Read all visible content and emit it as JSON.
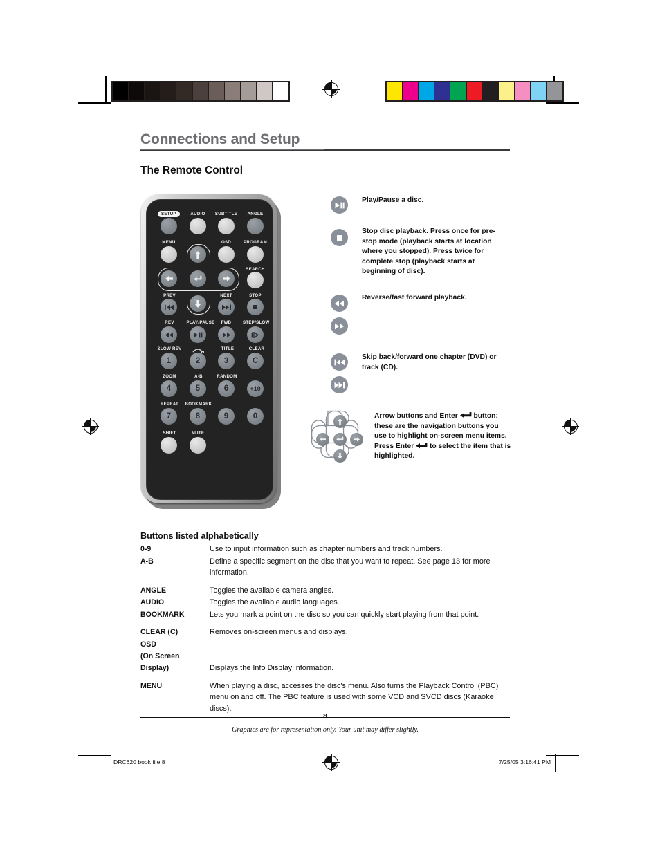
{
  "document": {
    "chapter_title": "Connections and Setup",
    "section_title": "The Remote Control",
    "page_number": "8",
    "footnote": "Graphics are for representation only. Your unit may differ slightly.",
    "slug_left": "DRC620 book file   8",
    "slug_right": "7/25/05   3:16:41 PM"
  },
  "color_bars": {
    "grayscale": [
      "#000000",
      "#0d0a09",
      "#1a1513",
      "#241d1a",
      "#332a26",
      "#4b403b",
      "#6b5d57",
      "#8b7e78",
      "#a69c97",
      "#cfc8c4",
      "#ffffff"
    ],
    "color": [
      "#ffe600",
      "#ec008c",
      "#00a7e7",
      "#2e3191",
      "#00a451",
      "#ed1c24",
      "#231f20",
      "#fbf08a",
      "#f58fc2",
      "#7fd4f5",
      "#939598"
    ]
  },
  "remote": {
    "rows": [
      {
        "labels": [
          "SETUP",
          "AUDIO",
          "SUBTITLE",
          "ANGLE"
        ],
        "buttons": [
          "",
          "",
          "",
          ""
        ]
      },
      {
        "labels": [
          "MENU",
          "",
          "OSD",
          "PROGRAM"
        ],
        "buttons": [
          "",
          "",
          "",
          ""
        ]
      },
      {
        "labels": [
          "",
          "",
          "",
          "SEARCH"
        ],
        "buttons": [
          "",
          "",
          "",
          ""
        ]
      },
      {
        "labels": [
          "PREV",
          "",
          "NEXT",
          "STOP"
        ],
        "buttons": [
          "",
          "",
          "",
          ""
        ]
      },
      {
        "labels": [
          "REV",
          "PLAY/PAUSE",
          "FWD",
          "STEP/SLOW"
        ],
        "buttons": [
          "",
          "",
          "",
          ""
        ]
      },
      {
        "labels": [
          "SLOW REV",
          "",
          "TITLE",
          "CLEAR"
        ],
        "buttons": [
          "1",
          "2",
          "3",
          "C"
        ]
      },
      {
        "labels": [
          "ZOOM",
          "A-B",
          "RANDOM",
          ""
        ],
        "buttons": [
          "4",
          "5",
          "6",
          "+10"
        ]
      },
      {
        "labels": [
          "REPEAT",
          "BOOKMARK",
          "",
          ""
        ],
        "buttons": [
          "7",
          "8",
          "9",
          "0"
        ]
      },
      {
        "labels": [
          "SHIFT",
          "MUTE",
          "",
          ""
        ],
        "buttons": [
          "",
          ""
        ]
      }
    ],
    "setup_label": "SETUP",
    "audio_label": "AUDIO",
    "subtitle_label": "SUBTITLE",
    "angle_label": "ANGLE",
    "menu_label": "MENU",
    "osd_label": "OSD",
    "program_label": "PROGRAM",
    "search_label": "SEARCH",
    "prev_label": "PREV",
    "next_label": "NEXT",
    "stop_label": "STOP",
    "rev_label": "REV",
    "play_pause_label": "PLAY/PAUSE",
    "fwd_label": "FWD",
    "step_slow_label": "STEP/SLOW",
    "slow_rev_label": "SLOW REV",
    "title_label": "TITLE",
    "clear_label": "CLEAR",
    "zoom_label": "ZOOM",
    "ab_label": "A-B",
    "random_label": "RANDOM",
    "repeat_label": "REPEAT",
    "bookmark_label": "BOOKMARK",
    "shift_label": "SHIFT",
    "mute_label": "MUTE",
    "num1": "1",
    "num2": "2",
    "num3": "3",
    "numC": "C",
    "num4": "4",
    "num5": "5",
    "num6": "6",
    "numPlus10": "+10",
    "num7": "7",
    "num8": "8",
    "num9": "9",
    "num0": "0"
  },
  "annotations": [
    {
      "icon": "play-pause-icon",
      "text": "Play/Pause a disc."
    },
    {
      "icon": "stop-icon",
      "text": "Stop disc playback. Press once for pre-stop mode (playback starts at location where you stopped). Press twice for complete stop (playback starts at beginning of disc)."
    },
    {
      "icon": "rewind-icon",
      "icon2": "fast-forward-icon",
      "text": "Reverse/fast forward playback."
    },
    {
      "icon": "skip-back-icon",
      "icon2": "skip-forward-icon",
      "text": "Skip back/forward one chapter (DVD) or track (CD)."
    },
    {
      "icon": "dpad-icon",
      "text": "Arrow buttons and Enter ↩ button: these are the navigation buttons you use to highlight on-screen menu items. Press Enter ↩ to select the item that is highlighted."
    }
  ],
  "annotation_texts": {
    "play_pause": "Play/Pause a disc.",
    "stop": "Stop disc playback. Press once for pre-stop mode (playback starts at location where you stopped). Press twice for complete stop (playback starts at beginning of disc).",
    "reverse_forward": "Reverse/fast forward playback.",
    "skip": "Skip back/forward one chapter (DVD) or track (CD).",
    "navigation_a": "Arrow buttons and Enter ",
    "navigation_b": " button: these are the navigation buttons you use to highlight on-screen menu items. Press Enter ",
    "navigation_c": " to select the item that is highlighted."
  },
  "alphabetical": {
    "title": "Buttons listed alphabetically",
    "entries": [
      {
        "term": "0-9",
        "desc": "Use to input information such as chapter numbers and track numbers.",
        "gap": false
      },
      {
        "term": "A-B",
        "desc": "Define a specific segment on the disc that you want to repeat. See page 13 for more information.",
        "gap": false
      },
      {
        "term": "ANGLE",
        "desc": "Toggles the available camera angles.",
        "gap": true
      },
      {
        "term": "AUDIO",
        "desc": "Toggles the available audio languages.",
        "gap": false
      },
      {
        "term": "BOOKMARK",
        "desc": "Lets you mark a point on the disc so you can quickly start playing from that point.",
        "gap": false
      },
      {
        "term": "CLEAR (C)",
        "desc": "Removes on-screen menus and displays.",
        "gap": true
      },
      {
        "term": "OSD",
        "desc": "",
        "gap": false
      },
      {
        "term": "(On Screen",
        "desc": "",
        "gap": false
      },
      {
        "term": "Display)",
        "desc": "Displays the Info Display information.",
        "gap": false
      },
      {
        "term": "MENU",
        "desc": "When playing a disc, accesses the disc's menu. Also turns the Playback Control (PBC) menu on and off. The PBC feature is used with some VCD and SVCD discs (Karaoke discs).",
        "gap": true
      }
    ]
  }
}
